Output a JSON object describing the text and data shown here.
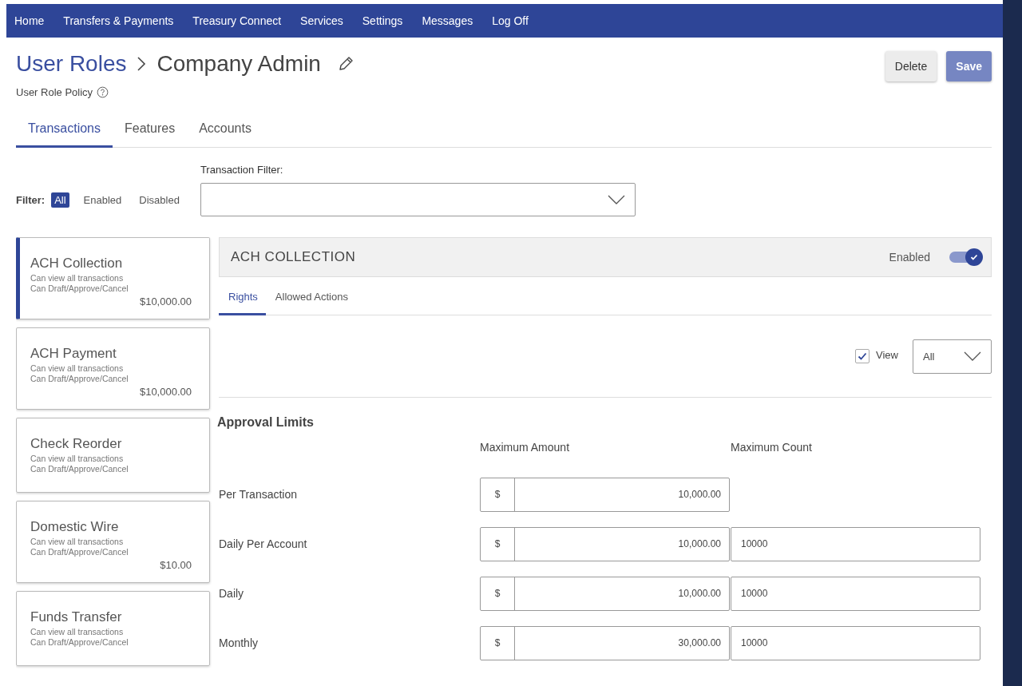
{
  "nav": [
    "Home",
    "Transfers & Payments",
    "Treasury Connect",
    "Services",
    "Settings",
    "Messages",
    "Log Off"
  ],
  "breadcrumb": {
    "parent": "User Roles",
    "current": "Company Admin"
  },
  "subtitle": "User Role Policy",
  "actions": [
    {
      "label": "Delete",
      "kind": "secondary"
    },
    {
      "label": "Save",
      "kind": "primary"
    }
  ],
  "tabs": [
    {
      "label": "Transactions",
      "selected": true
    },
    {
      "label": "Features",
      "selected": false
    },
    {
      "label": "Accounts",
      "selected": false
    }
  ],
  "filter": {
    "label": "Filter:",
    "options": [
      {
        "label": "All",
        "selected": true
      },
      {
        "label": "Enabled",
        "selected": false
      },
      {
        "label": "Disabled",
        "selected": false
      }
    ]
  },
  "transaction_filter": {
    "label": "Transaction Filter:"
  },
  "transactions": [
    {
      "name": "ACH Collection",
      "lines": [
        "Can view all transactions",
        "Can Draft/Approve/Cancel"
      ],
      "amount": "$10,000.00",
      "selected": true
    },
    {
      "name": "ACH Payment",
      "lines": [
        "Can view all transactions",
        "Can Draft/Approve/Cancel"
      ],
      "amount": "$10,000.00",
      "selected": false
    },
    {
      "name": "Check Reorder",
      "lines": [
        "Can view all transactions",
        "Can Draft/Approve/Cancel"
      ],
      "selected": false
    },
    {
      "name": "Domestic Wire",
      "lines": [
        "Can view all transactions",
        "Can Draft/Approve/Cancel"
      ],
      "amount": "$10.00",
      "selected": false
    },
    {
      "name": "Funds Transfer",
      "lines": [
        "Can view all transactions",
        "Can Draft/Approve/Cancel"
      ],
      "selected": false
    }
  ],
  "detail": {
    "title": "ACH COLLECTION",
    "status_label": "Enabled",
    "enabled": true,
    "subtabs": [
      {
        "label": "Rights",
        "selected": true
      },
      {
        "label": "Allowed Actions",
        "selected": false
      }
    ],
    "view": {
      "label": "View",
      "checked": true,
      "scope": "All"
    },
    "limits": {
      "title": "Approval Limits",
      "columns": [
        "Maximum Amount",
        "Maximum Count"
      ],
      "rows": [
        {
          "label": "Per Transaction",
          "currency": "$",
          "amount": "10,000.00"
        },
        {
          "label": "Daily Per Account",
          "currency": "$",
          "amount": "10,000.00",
          "count": "10000"
        },
        {
          "label": "Daily",
          "currency": "$",
          "amount": "10,000.00",
          "count": "10000"
        },
        {
          "label": "Monthly",
          "currency": "$",
          "amount": "30,000.00",
          "count": "10000"
        }
      ]
    }
  }
}
